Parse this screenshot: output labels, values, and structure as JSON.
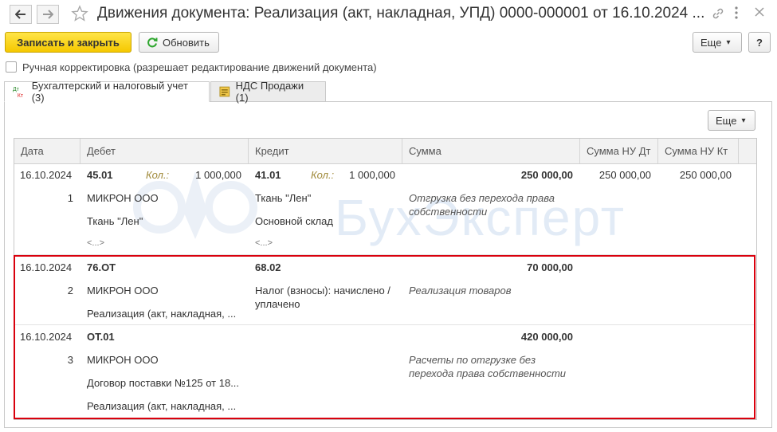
{
  "window": {
    "title": "Движения документа: Реализация (акт, накладная, УПД) 0000-000001 от 16.10.2024 ..."
  },
  "toolbar": {
    "save_close": "Записать и закрыть",
    "refresh": "Обновить",
    "more": "Еще",
    "more_arrow": "▾",
    "help": "?"
  },
  "manual": {
    "label": "Ручная корректировка (разрешает редактирование движений документа)"
  },
  "tabs": [
    {
      "label": "Бухгалтерский и налоговый учет (3)",
      "icon": "dt-kt-icon"
    },
    {
      "label": "НДС Продажи (1)",
      "icon": "vat-register-icon"
    }
  ],
  "grid_toolbar": {
    "more": "Еще",
    "more_arrow": "▾"
  },
  "columns": [
    "Дата",
    "Дебет",
    "Кредит",
    "Сумма",
    "Сумма НУ Дт",
    "Сумма НУ Кт"
  ],
  "watermark": "БухЭксперт",
  "rows": [
    {
      "date": "16.10.2024",
      "num": "1",
      "debit_account": "45.01",
      "debit_kol_label": "Кол.:",
      "debit_qty": "1 000,000",
      "credit_account": "41.01",
      "credit_kol_label": "Кол.:",
      "credit_qty": "1 000,000",
      "sum": "250 000,00",
      "sum_nu_dt": "250 000,00",
      "sum_nu_kt": "250 000,00",
      "debit_sub1": "МИКРОН ООО",
      "debit_sub2": "Ткань \"Лен\"",
      "debit_sub3": "<...>",
      "credit_sub1": "Ткань \"Лен\"",
      "credit_sub2": "Основной склад",
      "credit_sub3": "<...>",
      "content_line1": "Отгрузка без перехода права",
      "content_line2": "собственности"
    },
    {
      "date": "16.10.2024",
      "num": "2",
      "debit_account": "76.ОТ",
      "credit_account": "68.02",
      "sum": "70 000,00",
      "debit_sub1": "МИКРОН ООО",
      "debit_sub2": "Реализация (акт, накладная, ...",
      "credit_sub1_line1": "Налог (взносы): начислено /",
      "credit_sub1_line2": "уплачено",
      "content_line1": "Реализация товаров"
    },
    {
      "date": "16.10.2024",
      "num": "3",
      "debit_account": "ОТ.01",
      "sum": "420 000,00",
      "debit_sub1": "МИКРОН ООО",
      "debit_sub2": "Договор поставки №125 от 18...",
      "debit_sub3": "Реализация (акт, накладная, ...",
      "content_line1": "Расчеты по отгрузке без",
      "content_line2": "перехода права собственности"
    }
  ],
  "colors": {
    "highlight": "#d9000d",
    "primary_button": "#f5c800"
  }
}
